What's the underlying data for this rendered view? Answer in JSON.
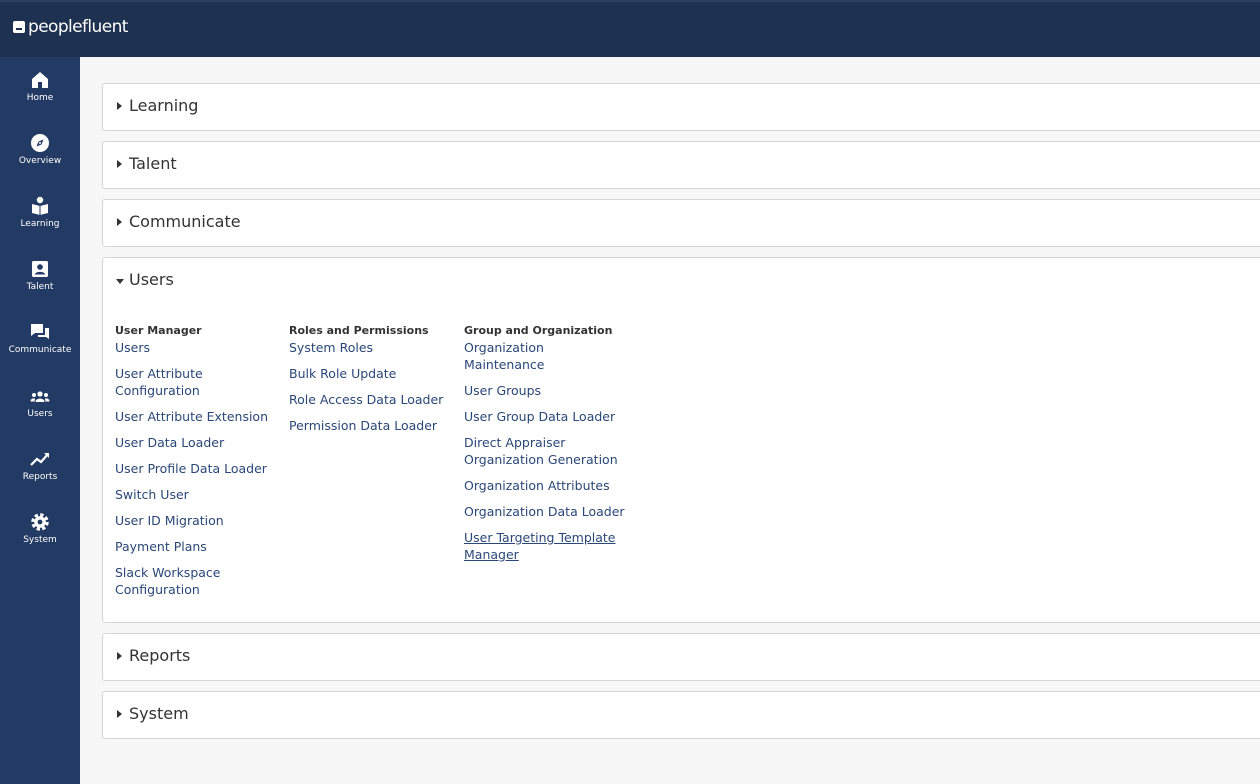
{
  "brand": {
    "name": "peoplefluent"
  },
  "sidebar": {
    "items": [
      {
        "label": "Home",
        "icon": "home-icon"
      },
      {
        "label": "Overview",
        "icon": "compass-icon"
      },
      {
        "label": "Learning",
        "icon": "learning-icon"
      },
      {
        "label": "Talent",
        "icon": "id-card-icon"
      },
      {
        "label": "Communicate",
        "icon": "chat-icon"
      },
      {
        "label": "Users",
        "icon": "users-icon"
      },
      {
        "label": "Reports",
        "icon": "line-chart-icon"
      },
      {
        "label": "System",
        "icon": "gear-icon"
      }
    ]
  },
  "panels": {
    "learning": {
      "title": "Learning"
    },
    "talent": {
      "title": "Talent"
    },
    "communicate": {
      "title": "Communicate"
    },
    "users": {
      "title": "Users",
      "columns": [
        {
          "heading": "User Manager",
          "links": [
            "Users",
            "User Attribute Configuration",
            "User Attribute Extension",
            "User Data Loader",
            "User Profile Data Loader",
            "Switch User",
            "User ID Migration",
            "Payment Plans",
            "Slack Workspace Configuration"
          ]
        },
        {
          "heading": "Roles and Permissions",
          "links": [
            "System Roles",
            "Bulk Role Update",
            "Role Access Data Loader",
            "Permission Data Loader"
          ]
        },
        {
          "heading": "Group and Organization",
          "links": [
            "Organization Maintenance",
            "User Groups",
            "User Group Data Loader",
            "Direct Appraiser Organization Generation",
            "Organization Attributes",
            "Organization Data Loader",
            "User Targeting Template Manager"
          ]
        }
      ]
    },
    "reports": {
      "title": "Reports"
    },
    "system": {
      "title": "System"
    }
  },
  "colors": {
    "topbar": "#1e3150",
    "sidebar": "#233b64",
    "link": "#2a4778"
  }
}
